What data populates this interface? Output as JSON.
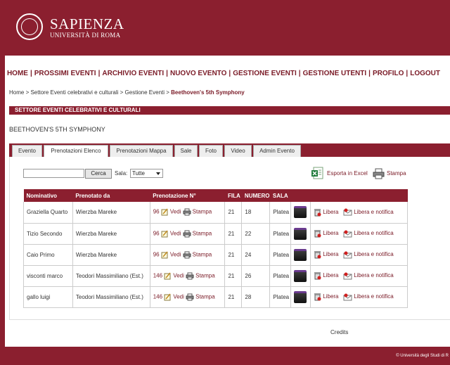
{
  "brand": {
    "name": "SAPIENZA",
    "subtitle": "UNIVERSITÀ DI ROMA"
  },
  "nav": {
    "items": [
      "HOME",
      "PROSSIMI EVENTI",
      "ARCHIVIO EVENTI",
      "NUOVO EVENTO",
      "GESTIONE EVENTI",
      "GESTIONE UTENTI",
      "PROFILO",
      "LOGOUT"
    ],
    "separator": "|"
  },
  "breadcrumb": {
    "home": "Home",
    "sep": " > ",
    "section": "Settore Eventi celebrativi e culturali",
    "management": "Gestione Eventi",
    "current": "Beethoven's 5th Symphony"
  },
  "section_title": "SETTORE EVENTI CELEBRATIVI E CULTURALI",
  "event_title": "BEETHOVEN'S 5TH SYMPHONY",
  "tabs": [
    "Evento",
    "Prenotazioni Elenco",
    "Prenotazioni Mappa",
    "Sale",
    "Foto",
    "Video",
    "Admin Evento"
  ],
  "active_tab": "Prenotazioni Elenco",
  "search": {
    "value": "",
    "button_label": "Cerca",
    "sala_label": "Sala:",
    "sala_selected": "Tutte"
  },
  "actions": {
    "export_label": "Esporta in Excel",
    "print_label": "Stampa"
  },
  "table": {
    "headers": [
      "Nominativo",
      "Prenotato da",
      "Prenotazione N°",
      "FILA",
      "NUMERO",
      "SALA",
      "",
      ""
    ],
    "vedi_label": "Vedi",
    "stampa_label": "Stampa",
    "libera_label": "Libera",
    "libera_notifica_label": "Libera e notifica",
    "rows": [
      {
        "nominativo": "Graziella Quarto",
        "prenotato_da": "Wierzba Mareke",
        "numero_prenotazione": "96",
        "fila": "21",
        "numero": "18",
        "sala": "Platea"
      },
      {
        "nominativo": "Tizio Secondo",
        "prenotato_da": "Wierzba Mareke",
        "numero_prenotazione": "96",
        "fila": "21",
        "numero": "22",
        "sala": "Platea"
      },
      {
        "nominativo": "Caio Primo",
        "prenotato_da": "Wierzba Mareke",
        "numero_prenotazione": "96",
        "fila": "21",
        "numero": "24",
        "sala": "Platea"
      },
      {
        "nominativo": "visconti marco",
        "prenotato_da": "Teodori Massimiliano (Est.)",
        "numero_prenotazione": "146",
        "fila": "21",
        "numero": "26",
        "sala": "Platea"
      },
      {
        "nominativo": "gallo luigi",
        "prenotato_da": "Teodori Massimiliano (Est.)",
        "numero_prenotazione": "146",
        "fila": "21",
        "numero": "28",
        "sala": "Platea"
      }
    ]
  },
  "credits": "Credits",
  "footer": "© Università degli Studi di R",
  "colors": {
    "brand": "#8b1f2f",
    "link": "#7a1a26"
  }
}
